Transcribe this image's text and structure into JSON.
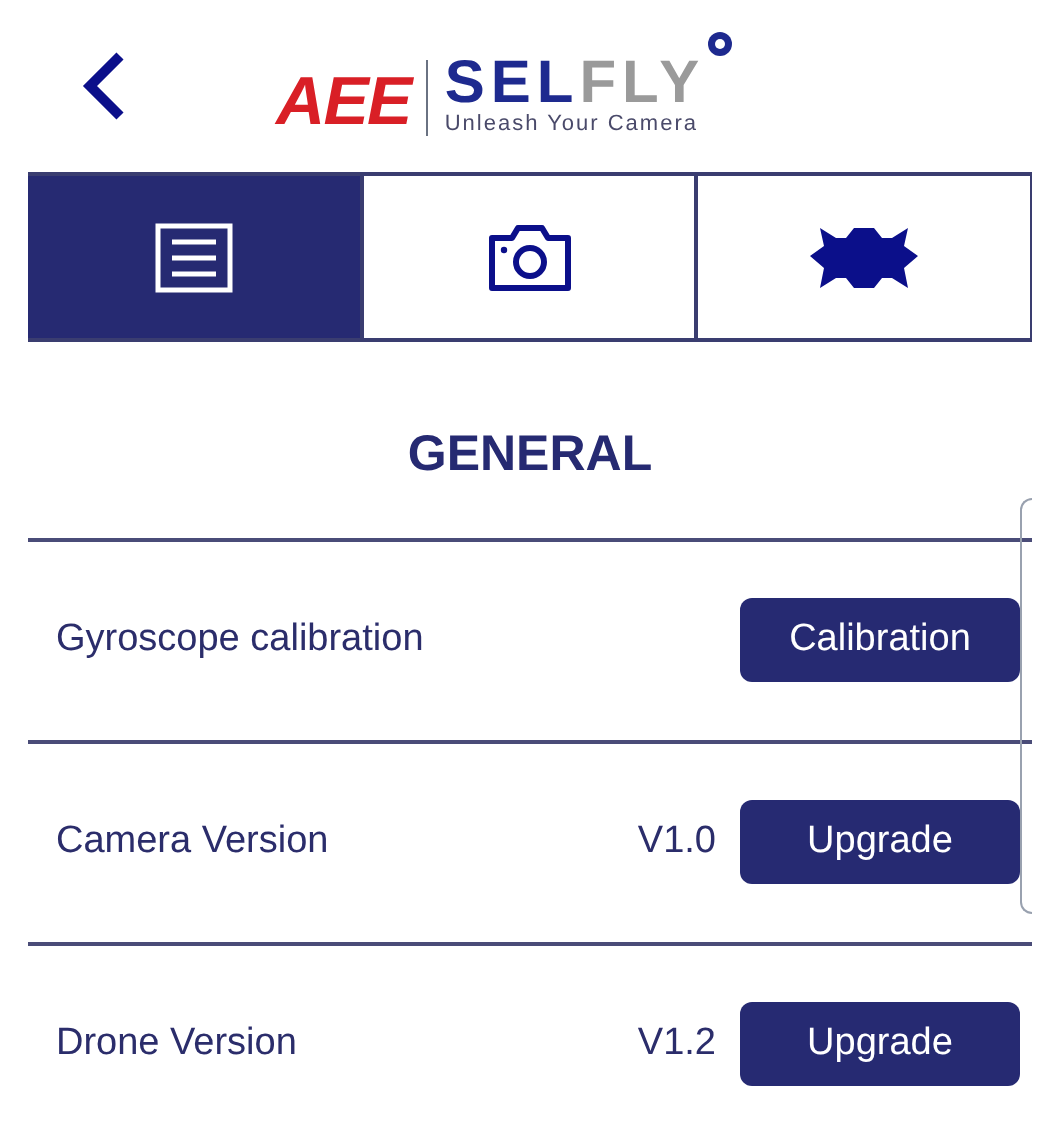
{
  "header": {
    "logo_mark": "AEE",
    "brand": "SELFLY",
    "tagline": "Unleash Your Camera"
  },
  "tabs": [
    {
      "kind": "list",
      "selected": true
    },
    {
      "kind": "camera",
      "selected": false
    },
    {
      "kind": "drone",
      "selected": false
    }
  ],
  "section_title": "GENERAL",
  "rows": [
    {
      "label": "Gyroscope calibration",
      "button": "Calibration"
    },
    {
      "label": "Camera Version",
      "version": "V1.0",
      "button": "Upgrade"
    },
    {
      "label": "Drone Version",
      "version": "V1.2",
      "button": "Upgrade"
    }
  ]
}
